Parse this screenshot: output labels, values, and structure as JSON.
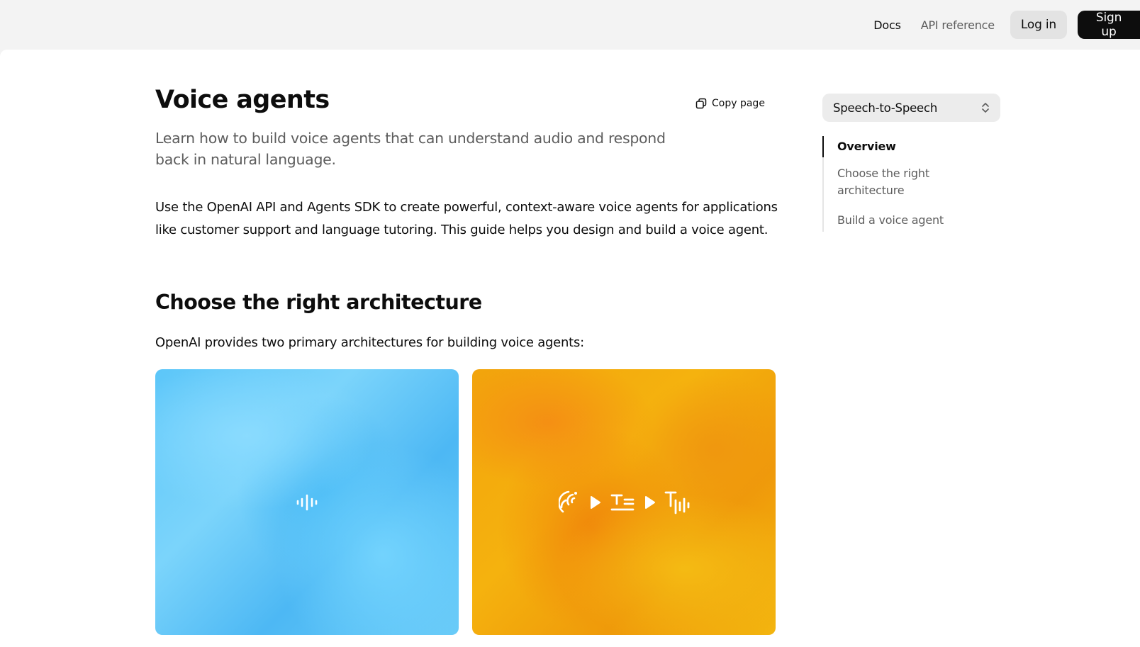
{
  "nav": {
    "docs": "Docs",
    "api_reference": "API reference",
    "login": "Log in",
    "signup": "Sign up"
  },
  "page": {
    "title": "Voice agents",
    "copy_page": "Copy page",
    "subtitle": "Learn how to build voice agents that can understand audio and respond back in natural language.",
    "intro": "Use the OpenAI API and Agents SDK to create powerful, context-aware voice agents for applications like customer support and language tutoring. This guide helps you design and build a voice agent.",
    "section_title": "Choose the right architecture",
    "section_text": "OpenAI provides two primary architectures for building voice agents:"
  },
  "cards": [
    {
      "icons": [
        "waveform-icon"
      ],
      "color": "#5cc6f9"
    },
    {
      "icons": [
        "speech-input-icon",
        "play-icon",
        "text-icon",
        "play-icon",
        "text-to-speech-icon"
      ],
      "color": "#f2a40c"
    }
  ],
  "sidebar": {
    "select_value": "Speech-to-Speech",
    "toc": [
      {
        "label": "Overview",
        "active": true
      },
      {
        "label": "Choose the right architecture",
        "active": false
      },
      {
        "label": "Build a voice agent",
        "active": false
      }
    ]
  }
}
